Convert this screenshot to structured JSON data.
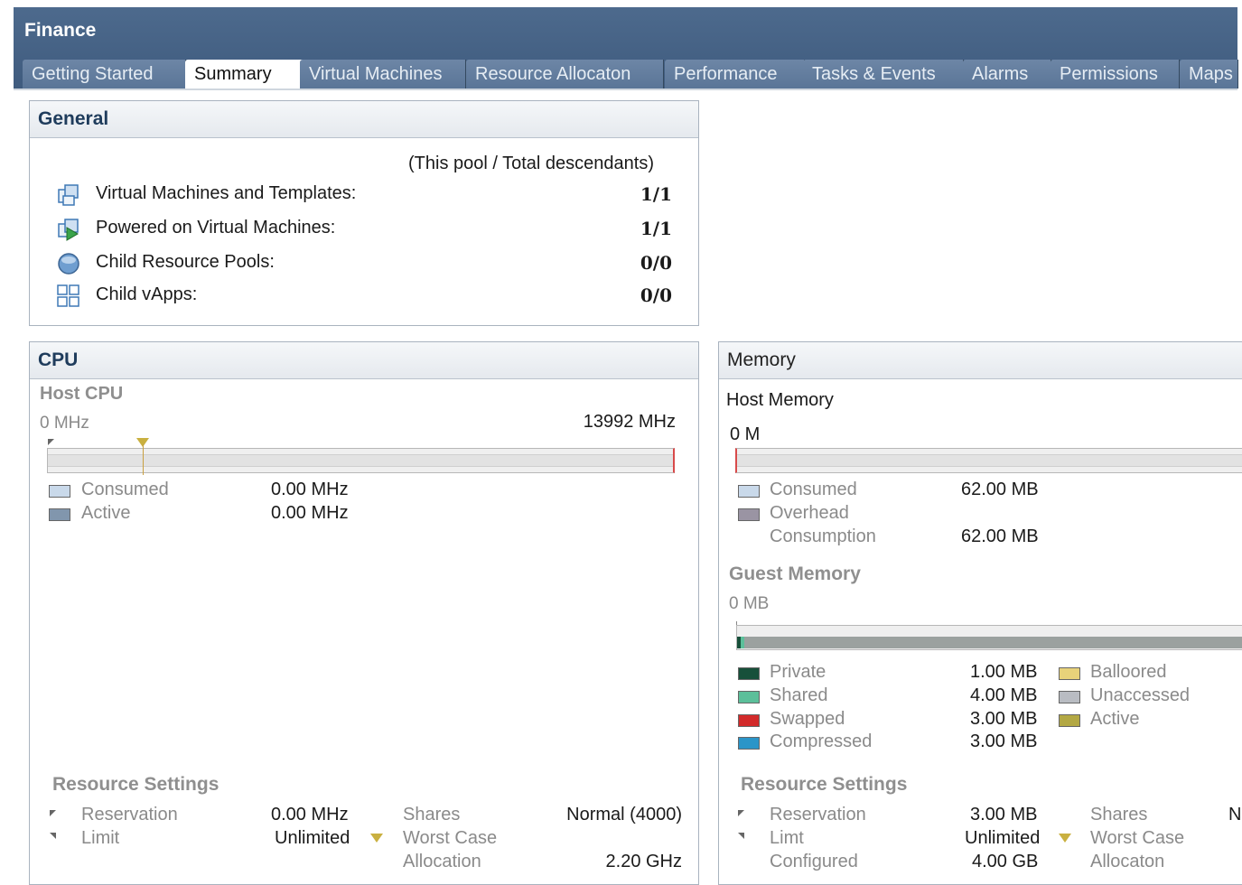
{
  "window": {
    "title": "Finance",
    "tabs": [
      "Getting Started",
      "Summary",
      "Virtual Machines",
      "Resource Allocaton",
      "Performance",
      "Tasks & Events",
      "Alarms",
      "Permissions",
      "Maps"
    ],
    "active_tab": "Summary"
  },
  "general": {
    "header": "General",
    "subheader": "(This pool / Total descendants)",
    "rows": [
      {
        "icon": "vm-templates-icon",
        "label": "Virtual Machines and Templates:",
        "value": "1/1"
      },
      {
        "icon": "powered-on-vm-icon",
        "label": "Powered on Virtual Machines:",
        "value": "1/1"
      },
      {
        "icon": "resource-pool-icon",
        "label": "Child Resource Pools:",
        "value": "0/0"
      },
      {
        "icon": "vapp-icon",
        "label": "Child vApps:",
        "value": "0/0"
      }
    ]
  },
  "cpu": {
    "header": "CPU",
    "host_label": "Host CPU",
    "min": "0 MHz",
    "max": "13992 MHz",
    "legend": [
      {
        "label": "Consumed",
        "value": "0.00 MHz",
        "color": "#c9d9ea"
      },
      {
        "label": "Active",
        "value": "0.00 MHz",
        "color": "#8196ad"
      }
    ],
    "rs_title": "Resource Settings",
    "rs": {
      "reservation_label": "Reservation",
      "reservation": "0.00 MHz",
      "limit_label": "Limit",
      "limit": "Unlimited",
      "shares_label": "Shares",
      "shares": "Normal (4000)",
      "wca_label1": "Worst Case",
      "wca_label2": "Allocation",
      "wca": "2.20 GHz"
    }
  },
  "memory": {
    "header": "Memory",
    "host_label": "Host Memory",
    "host_min": "0 M",
    "host_legend": [
      {
        "label": "Consumed",
        "value": "62.00 MB",
        "color": "#c9d9ea"
      },
      {
        "label": "Overhead",
        "value": "",
        "color": "#9a94a3"
      },
      {
        "label": "Consumption",
        "value": "62.00 MB",
        "color": ""
      }
    ],
    "guest_label": "Guest Memory",
    "guest_min": "0 MB",
    "guest_legend_left": [
      {
        "label": "Private",
        "value": "1.00 MB",
        "color": "#17503a"
      },
      {
        "label": "Shared",
        "value": "4.00 MB",
        "color": "#5cbf9a"
      },
      {
        "label": "Swapped",
        "value": "3.00 MB",
        "color": "#d22a2a"
      },
      {
        "label": "Compressed",
        "value": "3.00 MB",
        "color": "#2b95c8"
      }
    ],
    "guest_legend_right": [
      {
        "label": "Balloored",
        "color": "#e8d27a"
      },
      {
        "label": "Unaccessed",
        "color": "#b9bcc2"
      },
      {
        "label": "Active",
        "color": "#b3a844"
      }
    ],
    "rs_title": "Resource Settings",
    "rs": {
      "reservation_label": "Reservation",
      "reservation": "3.00 MB",
      "limit_label": "Limt",
      "limit": "Unlimited",
      "configured_label": "Configured",
      "configured": "4.00 GB",
      "shares_label": "Shares",
      "shares_cut": "N",
      "wca_label1": "Worst Case",
      "wca_label2": "Allocaton"
    }
  }
}
